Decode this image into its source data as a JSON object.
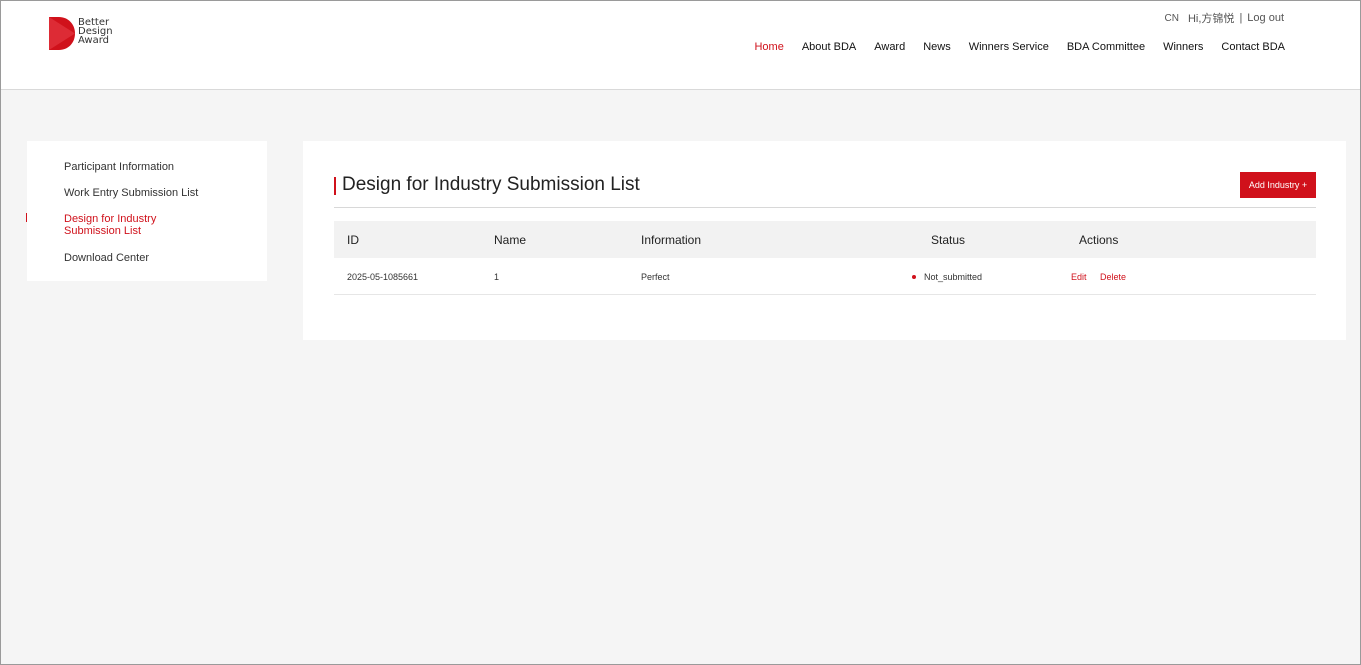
{
  "header": {
    "logo_lines": [
      "Better",
      "Design",
      "Award"
    ],
    "lang": "CN",
    "greeting": "Hi,方锦悦",
    "separator": "|",
    "logout": "Log out",
    "nav": [
      "Home",
      "About BDA",
      "Award",
      "News",
      "Winners Service",
      "BDA Committee",
      "Winners",
      "Contact BDA"
    ],
    "active_nav": "Home"
  },
  "sidebar": {
    "items": [
      {
        "label": "Participant Information"
      },
      {
        "label": "Work Entry Submission List"
      },
      {
        "label": "Design for Industry Submission List"
      },
      {
        "label": "Download Center"
      }
    ],
    "active_index": 2
  },
  "main": {
    "title": "Design for Industry Submission List",
    "add_button": "Add Industry +",
    "columns": [
      "ID",
      "Name",
      "Information",
      "Status",
      "Actions"
    ],
    "rows": [
      {
        "id": "2025-05-1085661",
        "name": "1",
        "information": "Perfect",
        "status": "Not_submitted",
        "actions": [
          "Edit",
          "Delete"
        ]
      }
    ]
  },
  "colors": {
    "accent": "#d0111b",
    "background": "#f5f5f5",
    "panel": "#ffffff",
    "table_header": "#f2f2f2"
  }
}
